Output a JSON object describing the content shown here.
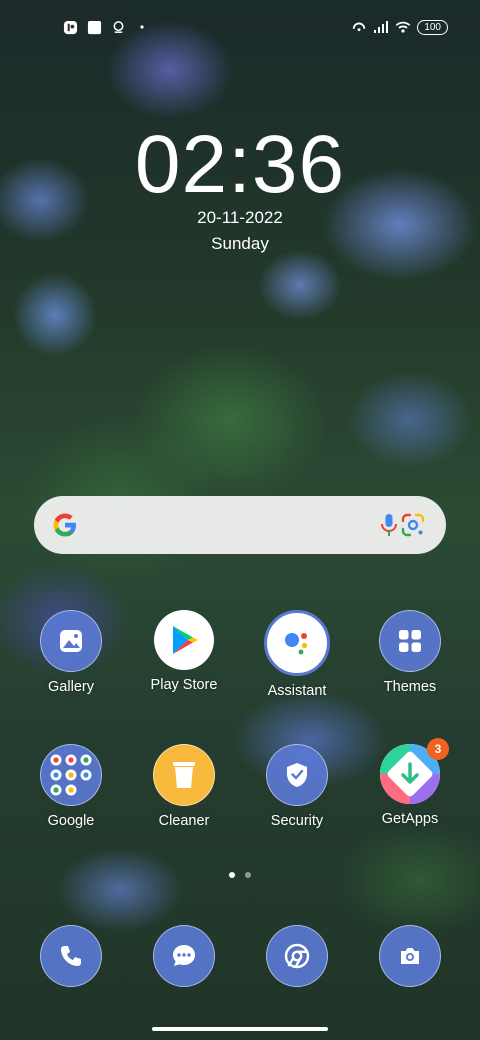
{
  "status_bar": {
    "left_icons": [
      "app-notification-icon",
      "gallery-notification-icon",
      "location-notification-icon",
      "more-dot-icon"
    ],
    "right_icons": [
      "hotspot-icon",
      "signal-icon",
      "wifi-icon"
    ],
    "battery": "100"
  },
  "lockclock": {
    "time": "02:36",
    "date": "20-11-2022",
    "day": "Sunday"
  },
  "search": {
    "icons": [
      "google-g-icon",
      "mic-icon",
      "lens-icon"
    ]
  },
  "apps_row1": [
    {
      "label": "Gallery"
    },
    {
      "label": "Play Store"
    },
    {
      "label": "Assistant"
    },
    {
      "label": "Themes"
    }
  ],
  "apps_row2": [
    {
      "label": "Google"
    },
    {
      "label": "Cleaner"
    },
    {
      "label": "Security"
    },
    {
      "label": "GetApps",
      "badge": "3"
    }
  ],
  "page_indicator": {
    "pages": 2,
    "current": 1
  },
  "dock": [
    "phone-icon",
    "messages-icon",
    "chrome-icon",
    "camera-icon"
  ],
  "colors": {
    "icon_bg": "#5a78d2",
    "badge": "#f0621e",
    "search_bg": "#f5f5f5"
  }
}
